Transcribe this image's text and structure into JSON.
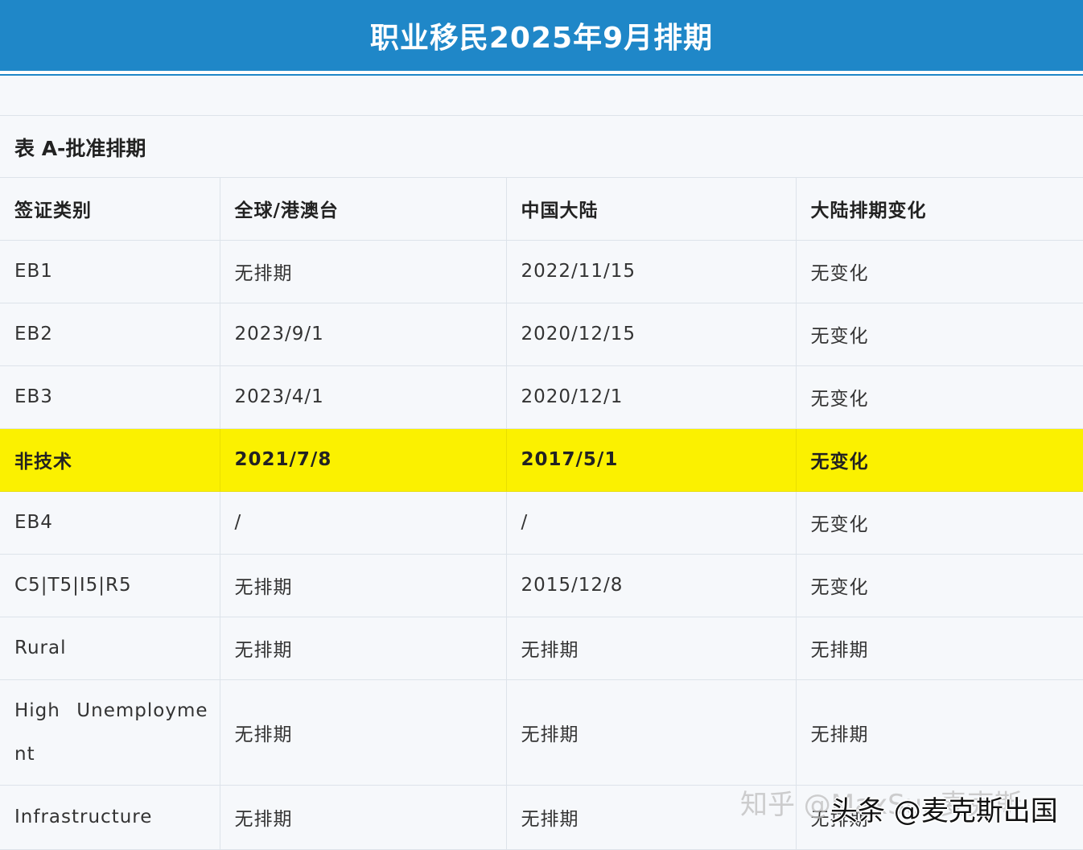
{
  "banner_title": "职业移民2025年9月排期",
  "caption": "表 A-批准排期",
  "table": {
    "headers": [
      "签证类别",
      "全球/港澳台",
      "中国大陆",
      "大陆排期变化"
    ],
    "rows": [
      [
        "EB1",
        "无排期",
        "2022/11/15",
        "无变化"
      ],
      [
        "EB2",
        "2023/9/1",
        "2020/12/15",
        "无变化"
      ],
      [
        "EB3",
        "2023/4/1",
        "2020/12/1",
        "无变化"
      ],
      [
        "非技术",
        "2021/7/8",
        "2017/5/1",
        "无变化"
      ],
      [
        "EB4",
        "/",
        "/",
        "无变化"
      ],
      [
        "C5|T5|I5|R5",
        "无排期",
        "2015/12/8",
        "无变化"
      ],
      [
        "Rural",
        "无排期",
        "无排期",
        "无排期"
      ],
      [
        "High Unemployment",
        "无排期",
        "无排期",
        "无排期"
      ],
      [
        "Infrastructure",
        "无排期",
        "无排期",
        "无排期"
      ]
    ]
  },
  "highlight_color": "#fbf100",
  "banner_color": "#1f87c8",
  "watermarks": {
    "faded": "知乎 @MaxSun麦克斯",
    "front": "头条 @麦克斯出国"
  }
}
